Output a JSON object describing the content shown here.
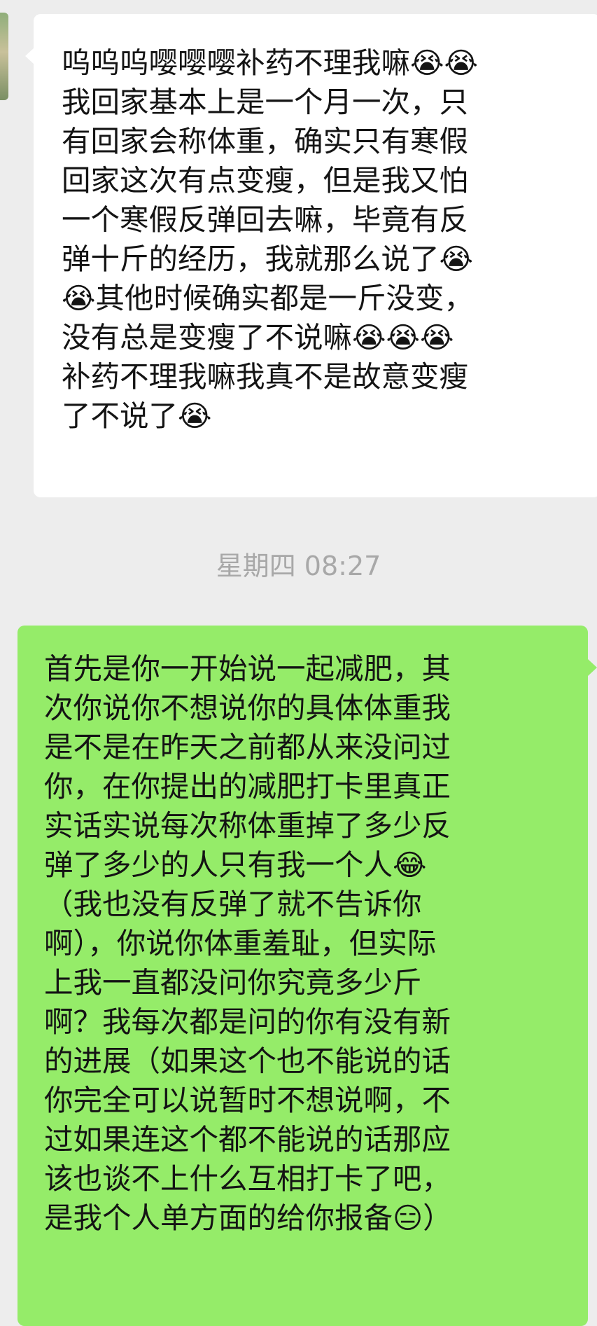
{
  "conversation": {
    "incoming_message": "呜呜呜嘤嘤嘤补药不理我嘛😭😭\n我回家基本上是一个月一次，只\n有回家会称体重，确实只有寒假\n回家这次有点变瘦，但是我又怕\n一个寒假反弹回去嘛，毕竟有反\n弹十斤的经历，我就那么说了😭\n😭其他时候确实都是一斤没变，\n没有总是变瘦了不说嘛😭😭😭\n补药不理我嘛我真不是故意变瘦\n了不说了😭",
    "timestamp": "星期四 08:27",
    "outgoing_message": "首先是你一开始说一起减肥，其\n次你说你不想说你的具体体重我\n是不是在昨天之前都从来没问过\n你，在你提出的减肥打卡里真正\n实话实说每次称体重掉了多少反\n弹了多少的人只有我一个人😂\n（我也没有反弹了就不告诉你\n啊），你说你体重羞耻，但实际\n上我一直都没问你究竟多少斤\n啊？我每次都是问的你有没有新\n的进展（如果这个也不能说的话\n你完全可以说暂时不想说啊，不\n过如果连这个都不能说的话那应\n该也谈不上什么互相打卡了吧，\n是我个人单方面的给你报备😑）"
  },
  "colors": {
    "background": "#ededed",
    "incoming_bubble": "#ffffff",
    "outgoing_bubble": "#95ec69",
    "timestamp_text": "#a8a8a8"
  }
}
